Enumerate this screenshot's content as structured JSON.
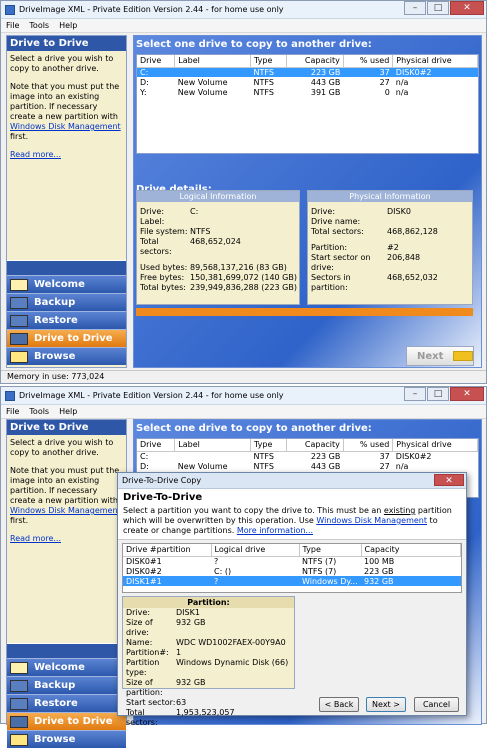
{
  "app_title": "DriveImage XML - Private Edition Version 2.44 - for home use only",
  "menu": [
    "File",
    "Tools",
    "Help"
  ],
  "window_buttons": {
    "minimize": "–",
    "maximize": "□",
    "close": "✕"
  },
  "sidebar": {
    "heading": "Drive to Drive",
    "text1": "Select a drive you wish to copy to another drive.",
    "text2_pre": "Note that you must put the image into an existing partition. If necessary create a new partition with ",
    "text2_link": "Windows Disk Management",
    "text2_post": " first.",
    "read_more": "Read more...",
    "nav": [
      "Welcome",
      "Backup",
      "Restore",
      "Drive to Drive",
      "Browse"
    ]
  },
  "main": {
    "select_title": "Select one drive to copy to another drive:",
    "columns": [
      "Drive",
      "Label",
      "Type",
      "Capacity",
      "% used",
      "Physical drive"
    ],
    "drives": [
      {
        "drive": "C:",
        "label": "",
        "type": "NTFS",
        "capacity": "223 GB",
        "used": "37",
        "physical": "DISK0#2"
      },
      {
        "drive": "D:",
        "label": "New Volume",
        "type": "NTFS",
        "capacity": "443 GB",
        "used": "27",
        "physical": "n/a"
      },
      {
        "drive": "Y:",
        "label": "New Volume",
        "type": "NTFS",
        "capacity": "391 GB",
        "used": "0",
        "physical": "n/a"
      }
    ],
    "details_title": "Drive details:",
    "logical_header": "Logical Information",
    "physical_header": "Physical Information",
    "logical": [
      [
        "Drive:",
        "C:"
      ],
      [
        "Label:",
        ""
      ],
      [
        "File system:",
        "NTFS"
      ],
      [
        "Total sectors:",
        "468,652,024"
      ],
      [
        "",
        ""
      ],
      [
        "Used bytes:",
        "89,568,137,216 (83 GB)"
      ],
      [
        "Free bytes:",
        "150,381,699,072 (140 GB)"
      ],
      [
        "Total bytes:",
        "239,949,836,288 (223 GB)"
      ]
    ],
    "physical": [
      [
        "Drive:",
        "DISK0"
      ],
      [
        "Drive name:",
        ""
      ],
      [
        "Total sectors:",
        "468,862,128"
      ],
      [
        "",
        ""
      ],
      [
        "Partition:",
        "#2"
      ],
      [
        "Start sector on drive:",
        "206,848"
      ],
      [
        "Sectors in partition:",
        "468,652,032"
      ]
    ],
    "next_label": "Next"
  },
  "status": "Memory in use: 773,024",
  "bottom_drives": [
    {
      "drive": "C:",
      "label": "",
      "type": "NTFS",
      "capacity": "223 GB",
      "used": "37",
      "physical": "DISK0#2"
    },
    {
      "drive": "D:",
      "label": "New Volume",
      "type": "NTFS",
      "capacity": "443 GB",
      "used": "27",
      "physical": "n/a"
    }
  ],
  "dialog": {
    "title": "Drive-To-Drive Copy",
    "heading": "Drive-To-Drive",
    "desc_pre": "Select a partition you want to copy the drive to. This must be an ",
    "desc_u": "existing",
    "desc_mid": " partition which will be overwritten by this operation. Use ",
    "desc_link": "Windows Disk Management",
    "desc_post": " to create or change partitions. ",
    "desc_more": "More information...",
    "columns": [
      "Drive #partition",
      "Logical drive",
      "Type",
      "Capacity"
    ],
    "rows": [
      {
        "part": "DISK0#1",
        "logical": "?",
        "type": "NTFS (7)",
        "capacity": "100 MB"
      },
      {
        "part": "DISK0#2",
        "logical": "C: ()",
        "type": "NTFS (7)",
        "capacity": "223 GB"
      },
      {
        "part": "DISK1#1",
        "logical": "?",
        "type": "Windows Dy...",
        "capacity": "932 GB"
      }
    ],
    "partition_header": "Partition:",
    "partition": [
      [
        "Drive:",
        "DISK1"
      ],
      [
        "Size of drive:",
        "932 GB"
      ],
      [
        "Name:",
        "WDC WD1002FAEX-00Y9A0"
      ],
      [
        "Partition#:",
        "1"
      ],
      [
        "Partition type:",
        "Windows Dynamic Disk (66)"
      ],
      [
        "Size of partition:",
        "932 GB"
      ],
      [
        "Start sector:",
        "63"
      ],
      [
        "Total sectors:",
        "1,953,523,057"
      ]
    ],
    "back": "< Back",
    "next": "Next >",
    "cancel": "Cancel"
  }
}
